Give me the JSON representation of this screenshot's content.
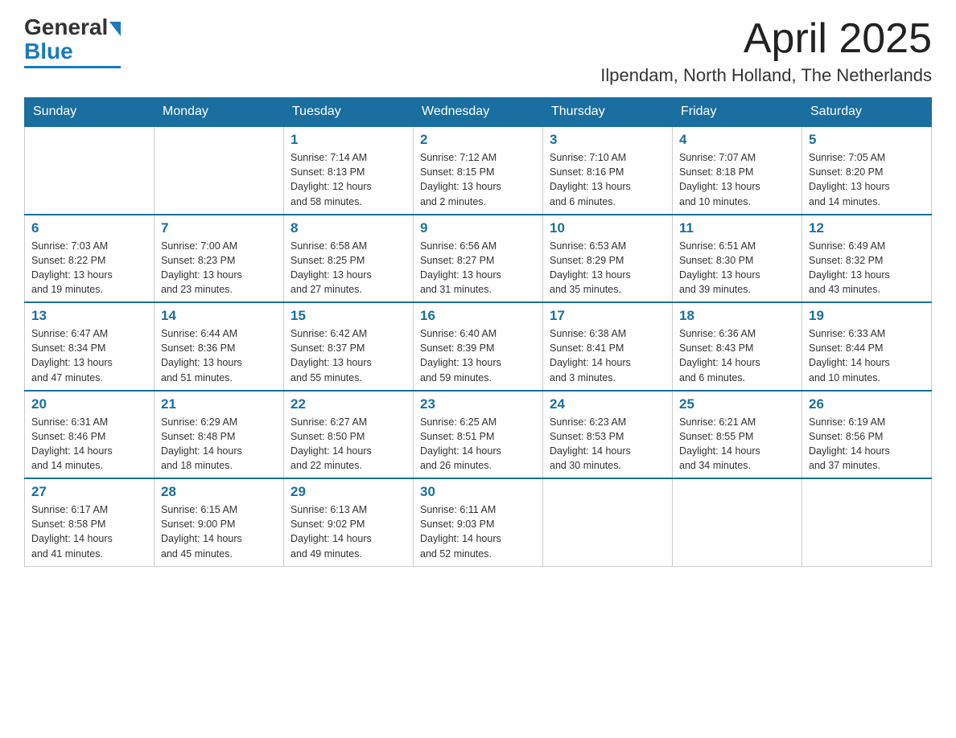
{
  "header": {
    "logo_general": "General",
    "logo_blue": "Blue",
    "month_title": "April 2025",
    "location": "Ilpendam, North Holland, The Netherlands"
  },
  "weekdays": [
    "Sunday",
    "Monday",
    "Tuesday",
    "Wednesday",
    "Thursday",
    "Friday",
    "Saturday"
  ],
  "weeks": [
    [
      {
        "day": "",
        "info": ""
      },
      {
        "day": "",
        "info": ""
      },
      {
        "day": "1",
        "info": "Sunrise: 7:14 AM\nSunset: 8:13 PM\nDaylight: 12 hours\nand 58 minutes."
      },
      {
        "day": "2",
        "info": "Sunrise: 7:12 AM\nSunset: 8:15 PM\nDaylight: 13 hours\nand 2 minutes."
      },
      {
        "day": "3",
        "info": "Sunrise: 7:10 AM\nSunset: 8:16 PM\nDaylight: 13 hours\nand 6 minutes."
      },
      {
        "day": "4",
        "info": "Sunrise: 7:07 AM\nSunset: 8:18 PM\nDaylight: 13 hours\nand 10 minutes."
      },
      {
        "day": "5",
        "info": "Sunrise: 7:05 AM\nSunset: 8:20 PM\nDaylight: 13 hours\nand 14 minutes."
      }
    ],
    [
      {
        "day": "6",
        "info": "Sunrise: 7:03 AM\nSunset: 8:22 PM\nDaylight: 13 hours\nand 19 minutes."
      },
      {
        "day": "7",
        "info": "Sunrise: 7:00 AM\nSunset: 8:23 PM\nDaylight: 13 hours\nand 23 minutes."
      },
      {
        "day": "8",
        "info": "Sunrise: 6:58 AM\nSunset: 8:25 PM\nDaylight: 13 hours\nand 27 minutes."
      },
      {
        "day": "9",
        "info": "Sunrise: 6:56 AM\nSunset: 8:27 PM\nDaylight: 13 hours\nand 31 minutes."
      },
      {
        "day": "10",
        "info": "Sunrise: 6:53 AM\nSunset: 8:29 PM\nDaylight: 13 hours\nand 35 minutes."
      },
      {
        "day": "11",
        "info": "Sunrise: 6:51 AM\nSunset: 8:30 PM\nDaylight: 13 hours\nand 39 minutes."
      },
      {
        "day": "12",
        "info": "Sunrise: 6:49 AM\nSunset: 8:32 PM\nDaylight: 13 hours\nand 43 minutes."
      }
    ],
    [
      {
        "day": "13",
        "info": "Sunrise: 6:47 AM\nSunset: 8:34 PM\nDaylight: 13 hours\nand 47 minutes."
      },
      {
        "day": "14",
        "info": "Sunrise: 6:44 AM\nSunset: 8:36 PM\nDaylight: 13 hours\nand 51 minutes."
      },
      {
        "day": "15",
        "info": "Sunrise: 6:42 AM\nSunset: 8:37 PM\nDaylight: 13 hours\nand 55 minutes."
      },
      {
        "day": "16",
        "info": "Sunrise: 6:40 AM\nSunset: 8:39 PM\nDaylight: 13 hours\nand 59 minutes."
      },
      {
        "day": "17",
        "info": "Sunrise: 6:38 AM\nSunset: 8:41 PM\nDaylight: 14 hours\nand 3 minutes."
      },
      {
        "day": "18",
        "info": "Sunrise: 6:36 AM\nSunset: 8:43 PM\nDaylight: 14 hours\nand 6 minutes."
      },
      {
        "day": "19",
        "info": "Sunrise: 6:33 AM\nSunset: 8:44 PM\nDaylight: 14 hours\nand 10 minutes."
      }
    ],
    [
      {
        "day": "20",
        "info": "Sunrise: 6:31 AM\nSunset: 8:46 PM\nDaylight: 14 hours\nand 14 minutes."
      },
      {
        "day": "21",
        "info": "Sunrise: 6:29 AM\nSunset: 8:48 PM\nDaylight: 14 hours\nand 18 minutes."
      },
      {
        "day": "22",
        "info": "Sunrise: 6:27 AM\nSunset: 8:50 PM\nDaylight: 14 hours\nand 22 minutes."
      },
      {
        "day": "23",
        "info": "Sunrise: 6:25 AM\nSunset: 8:51 PM\nDaylight: 14 hours\nand 26 minutes."
      },
      {
        "day": "24",
        "info": "Sunrise: 6:23 AM\nSunset: 8:53 PM\nDaylight: 14 hours\nand 30 minutes."
      },
      {
        "day": "25",
        "info": "Sunrise: 6:21 AM\nSunset: 8:55 PM\nDaylight: 14 hours\nand 34 minutes."
      },
      {
        "day": "26",
        "info": "Sunrise: 6:19 AM\nSunset: 8:56 PM\nDaylight: 14 hours\nand 37 minutes."
      }
    ],
    [
      {
        "day": "27",
        "info": "Sunrise: 6:17 AM\nSunset: 8:58 PM\nDaylight: 14 hours\nand 41 minutes."
      },
      {
        "day": "28",
        "info": "Sunrise: 6:15 AM\nSunset: 9:00 PM\nDaylight: 14 hours\nand 45 minutes."
      },
      {
        "day": "29",
        "info": "Sunrise: 6:13 AM\nSunset: 9:02 PM\nDaylight: 14 hours\nand 49 minutes."
      },
      {
        "day": "30",
        "info": "Sunrise: 6:11 AM\nSunset: 9:03 PM\nDaylight: 14 hours\nand 52 minutes."
      },
      {
        "day": "",
        "info": ""
      },
      {
        "day": "",
        "info": ""
      },
      {
        "day": "",
        "info": ""
      }
    ]
  ]
}
